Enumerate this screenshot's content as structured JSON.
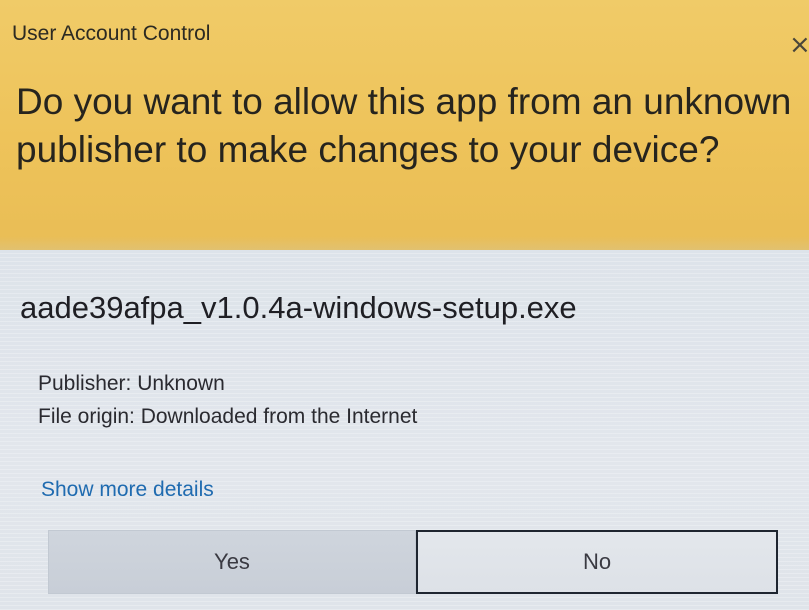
{
  "window": {
    "title": "User Account Control",
    "close_glyph": "×"
  },
  "header": {
    "question": "Do you want to allow this app from an unknown publisher to make changes to your device?"
  },
  "program": {
    "name": "aade39afpa_v1.0.4a-windows-setup.exe",
    "publisher": "Publisher: Unknown",
    "file_origin": "File origin: Downloaded from the Internet"
  },
  "links": {
    "show_more_details": "Show more details"
  },
  "buttons": {
    "yes_label": "Yes",
    "no_label": "No"
  },
  "colors": {
    "header_background": "#eec35a",
    "body_background": "#e0e5eb",
    "link": "#1f6bb0",
    "focused_button_border": "#1e2530"
  },
  "icons": {
    "close": "close-icon"
  }
}
